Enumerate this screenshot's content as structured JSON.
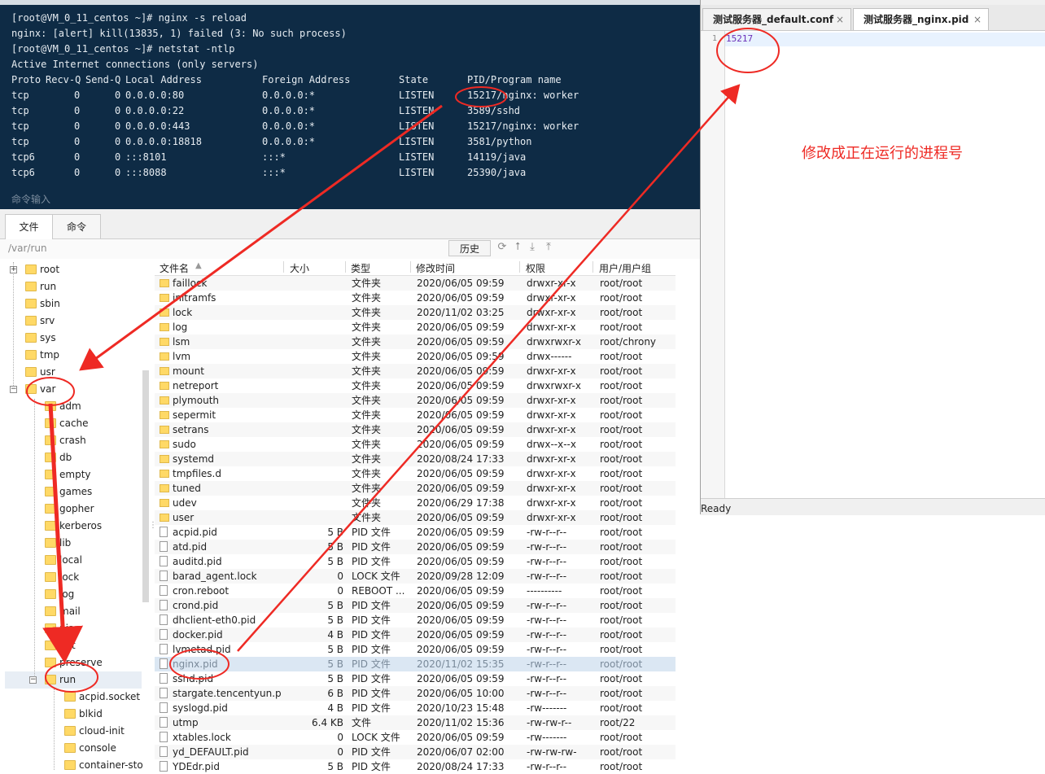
{
  "terminal": {
    "lines": [
      "[root@VM_0_11_centos ~]# nginx -s reload",
      "nginx: [alert] kill(13835, 1) failed (3: No such process)",
      "[root@VM_0_11_centos ~]# netstat -ntlp",
      "Active Internet connections (only servers)"
    ],
    "header": [
      "Proto",
      "Recv-Q",
      "Send-Q",
      "Local Address",
      "Foreign Address",
      "State",
      "PID/Program name"
    ],
    "rows": [
      [
        "tcp",
        "0",
        "0",
        "0.0.0.0:80",
        "0.0.0.0:*",
        "LISTEN",
        "15217/nginx: worker"
      ],
      [
        "tcp",
        "0",
        "0",
        "0.0.0.0:22",
        "0.0.0.0:*",
        "LISTEN",
        "3589/sshd"
      ],
      [
        "tcp",
        "0",
        "0",
        "0.0.0.0:443",
        "0.0.0.0:*",
        "LISTEN",
        "15217/nginx: worker"
      ],
      [
        "tcp",
        "0",
        "0",
        "0.0.0.0:18818",
        "0.0.0.0:*",
        "LISTEN",
        "3581/python"
      ],
      [
        "tcp6",
        "0",
        "0",
        ":::8101",
        ":::*",
        "LISTEN",
        "14119/java"
      ],
      [
        "tcp6",
        "0",
        "0",
        ":::8088",
        ":::*",
        "LISTEN",
        "25390/java"
      ]
    ],
    "input_hint": "命令输入"
  },
  "lower_tabs": [
    "文件",
    "命令"
  ],
  "path": "/var/run",
  "history_label": "历史",
  "toolbar_icons": [
    "refresh-icon",
    "upload-arrow-icon",
    "download-icon",
    "upload-icon"
  ],
  "tree": {
    "top_level": [
      "root",
      "run",
      "sbin",
      "srv",
      "sys",
      "tmp",
      "usr",
      "var"
    ],
    "var_children": [
      "adm",
      "cache",
      "crash",
      "db",
      "empty",
      "games",
      "gopher",
      "kerberos",
      "lib",
      "local",
      "lock",
      "log",
      "mail",
      "nis",
      "opt",
      "preserve",
      "run"
    ],
    "run_children": [
      "acpid.socket",
      "blkid",
      "cloud-init",
      "console",
      "container-sto"
    ]
  },
  "file_columns": [
    "文件名",
    "大小",
    "类型",
    "修改时间",
    "权限",
    "用户/用户组"
  ],
  "files": [
    {
      "name": "faillock",
      "size": "",
      "type": "文件夹",
      "mtime": "2020/06/05 09:59",
      "perm": "drwxr-xr-x",
      "owner": "root/root",
      "folder": true
    },
    {
      "name": "initramfs",
      "size": "",
      "type": "文件夹",
      "mtime": "2020/06/05 09:59",
      "perm": "drwxr-xr-x",
      "owner": "root/root",
      "folder": true
    },
    {
      "name": "lock",
      "size": "",
      "type": "文件夹",
      "mtime": "2020/11/02 03:25",
      "perm": "drwxr-xr-x",
      "owner": "root/root",
      "folder": true
    },
    {
      "name": "log",
      "size": "",
      "type": "文件夹",
      "mtime": "2020/06/05 09:59",
      "perm": "drwxr-xr-x",
      "owner": "root/root",
      "folder": true
    },
    {
      "name": "lsm",
      "size": "",
      "type": "文件夹",
      "mtime": "2020/06/05 09:59",
      "perm": "drwxrwxr-x",
      "owner": "root/chrony",
      "folder": true
    },
    {
      "name": "lvm",
      "size": "",
      "type": "文件夹",
      "mtime": "2020/06/05 09:59",
      "perm": "drwx------",
      "owner": "root/root",
      "folder": true
    },
    {
      "name": "mount",
      "size": "",
      "type": "文件夹",
      "mtime": "2020/06/05 09:59",
      "perm": "drwxr-xr-x",
      "owner": "root/root",
      "folder": true
    },
    {
      "name": "netreport",
      "size": "",
      "type": "文件夹",
      "mtime": "2020/06/05 09:59",
      "perm": "drwxrwxr-x",
      "owner": "root/root",
      "folder": true
    },
    {
      "name": "plymouth",
      "size": "",
      "type": "文件夹",
      "mtime": "2020/06/05 09:59",
      "perm": "drwxr-xr-x",
      "owner": "root/root",
      "folder": true
    },
    {
      "name": "sepermit",
      "size": "",
      "type": "文件夹",
      "mtime": "2020/06/05 09:59",
      "perm": "drwxr-xr-x",
      "owner": "root/root",
      "folder": true
    },
    {
      "name": "setrans",
      "size": "",
      "type": "文件夹",
      "mtime": "2020/06/05 09:59",
      "perm": "drwxr-xr-x",
      "owner": "root/root",
      "folder": true
    },
    {
      "name": "sudo",
      "size": "",
      "type": "文件夹",
      "mtime": "2020/06/05 09:59",
      "perm": "drwx--x--x",
      "owner": "root/root",
      "folder": true
    },
    {
      "name": "systemd",
      "size": "",
      "type": "文件夹",
      "mtime": "2020/08/24 17:33",
      "perm": "drwxr-xr-x",
      "owner": "root/root",
      "folder": true
    },
    {
      "name": "tmpfiles.d",
      "size": "",
      "type": "文件夹",
      "mtime": "2020/06/05 09:59",
      "perm": "drwxr-xr-x",
      "owner": "root/root",
      "folder": true
    },
    {
      "name": "tuned",
      "size": "",
      "type": "文件夹",
      "mtime": "2020/06/05 09:59",
      "perm": "drwxr-xr-x",
      "owner": "root/root",
      "folder": true
    },
    {
      "name": "udev",
      "size": "",
      "type": "文件夹",
      "mtime": "2020/06/29 17:38",
      "perm": "drwxr-xr-x",
      "owner": "root/root",
      "folder": true
    },
    {
      "name": "user",
      "size": "",
      "type": "文件夹",
      "mtime": "2020/06/05 09:59",
      "perm": "drwxr-xr-x",
      "owner": "root/root",
      "folder": true
    },
    {
      "name": "acpid.pid",
      "size": "5 B",
      "type": "PID 文件",
      "mtime": "2020/06/05 09:59",
      "perm": "-rw-r--r--",
      "owner": "root/root",
      "folder": false
    },
    {
      "name": "atd.pid",
      "size": "5 B",
      "type": "PID 文件",
      "mtime": "2020/06/05 09:59",
      "perm": "-rw-r--r--",
      "owner": "root/root",
      "folder": false
    },
    {
      "name": "auditd.pid",
      "size": "5 B",
      "type": "PID 文件",
      "mtime": "2020/06/05 09:59",
      "perm": "-rw-r--r--",
      "owner": "root/root",
      "folder": false
    },
    {
      "name": "barad_agent.lock",
      "size": "0",
      "type": "LOCK 文件",
      "mtime": "2020/09/28 12:09",
      "perm": "-rw-r--r--",
      "owner": "root/root",
      "folder": false
    },
    {
      "name": "cron.reboot",
      "size": "0",
      "type": "REBOOT ...",
      "mtime": "2020/06/05 09:59",
      "perm": "----------",
      "owner": "root/root",
      "folder": false
    },
    {
      "name": "crond.pid",
      "size": "5 B",
      "type": "PID 文件",
      "mtime": "2020/06/05 09:59",
      "perm": "-rw-r--r--",
      "owner": "root/root",
      "folder": false
    },
    {
      "name": "dhclient-eth0.pid",
      "size": "5 B",
      "type": "PID 文件",
      "mtime": "2020/06/05 09:59",
      "perm": "-rw-r--r--",
      "owner": "root/root",
      "folder": false
    },
    {
      "name": "docker.pid",
      "size": "4 B",
      "type": "PID 文件",
      "mtime": "2020/06/05 09:59",
      "perm": "-rw-r--r--",
      "owner": "root/root",
      "folder": false
    },
    {
      "name": "lvmetad.pid",
      "size": "5 B",
      "type": "PID 文件",
      "mtime": "2020/06/05 09:59",
      "perm": "-rw-r--r--",
      "owner": "root/root",
      "folder": false
    },
    {
      "name": "nginx.pid",
      "size": "5 B",
      "type": "PID 文件",
      "mtime": "2020/11/02 15:35",
      "perm": "-rw-r--r--",
      "owner": "root/root",
      "folder": false,
      "selected": true
    },
    {
      "name": "sshd.pid",
      "size": "5 B",
      "type": "PID 文件",
      "mtime": "2020/06/05 09:59",
      "perm": "-rw-r--r--",
      "owner": "root/root",
      "folder": false
    },
    {
      "name": "stargate.tencentyun.p...",
      "size": "6 B",
      "type": "PID 文件",
      "mtime": "2020/06/05 10:00",
      "perm": "-rw-r--r--",
      "owner": "root/root",
      "folder": false
    },
    {
      "name": "syslogd.pid",
      "size": "4 B",
      "type": "PID 文件",
      "mtime": "2020/10/23 15:48",
      "perm": "-rw-------",
      "owner": "root/root",
      "folder": false
    },
    {
      "name": "utmp",
      "size": "6.4 KB",
      "type": "文件",
      "mtime": "2020/11/02 15:36",
      "perm": "-rw-rw-r--",
      "owner": "root/22",
      "folder": false
    },
    {
      "name": "xtables.lock",
      "size": "0",
      "type": "LOCK 文件",
      "mtime": "2020/06/05 09:59",
      "perm": "-rw-------",
      "owner": "root/root",
      "folder": false
    },
    {
      "name": "yd_DEFAULT.pid",
      "size": "0",
      "type": "PID 文件",
      "mtime": "2020/06/07 02:00",
      "perm": "-rw-rw-rw-",
      "owner": "root/root",
      "folder": false
    },
    {
      "name": "YDEdr.pid",
      "size": "5 B",
      "type": "PID 文件",
      "mtime": "2020/08/24 17:33",
      "perm": "-rw-r--r--",
      "owner": "root/root",
      "folder": false
    }
  ],
  "editor": {
    "tabs": [
      "测试服务器_default.conf",
      "测试服务器_nginx.pid"
    ],
    "line_number": "1",
    "content": "15217",
    "status": "Ready"
  },
  "annotation_note": "修改成正在运行的进程号",
  "colors": {
    "terminal_bg": "#0e2b45",
    "annotation_red": "#ee2a24",
    "folder": "#ffd966"
  }
}
